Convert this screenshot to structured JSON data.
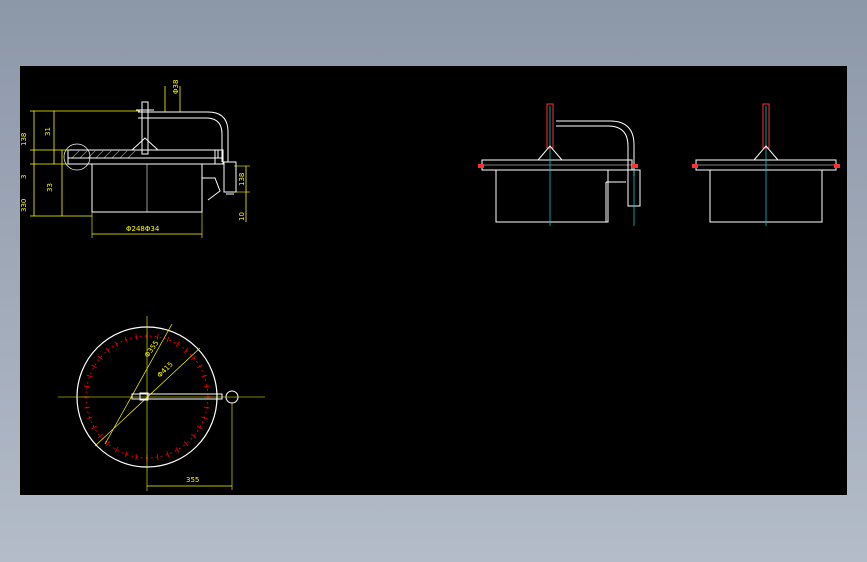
{
  "colors": {
    "background": "#8c97a8",
    "canvas": "#000000",
    "outline": "#ffffff",
    "dimension": "#ffff00",
    "centerline": "#00c8c8",
    "tick": "#ff0000",
    "hatch": "#9a9a9a",
    "detail": "#ff3030",
    "pipe": "#c8c8c8"
  },
  "front_view": {
    "dim_left": [
      "138",
      "31",
      "3",
      "33",
      "330"
    ],
    "dim_pipe": "Φ38",
    "dim_bottom": "Φ248Φ34",
    "dim_right": [
      "138",
      "10"
    ]
  },
  "plan_view": {
    "dim_d1": "Φ355",
    "dim_d2": "Φ415",
    "dim_bottom": "355",
    "tick_count": 36
  },
  "icons": {
    "handle_bolt": "bolt-icon",
    "hinge": "hinge-icon"
  }
}
